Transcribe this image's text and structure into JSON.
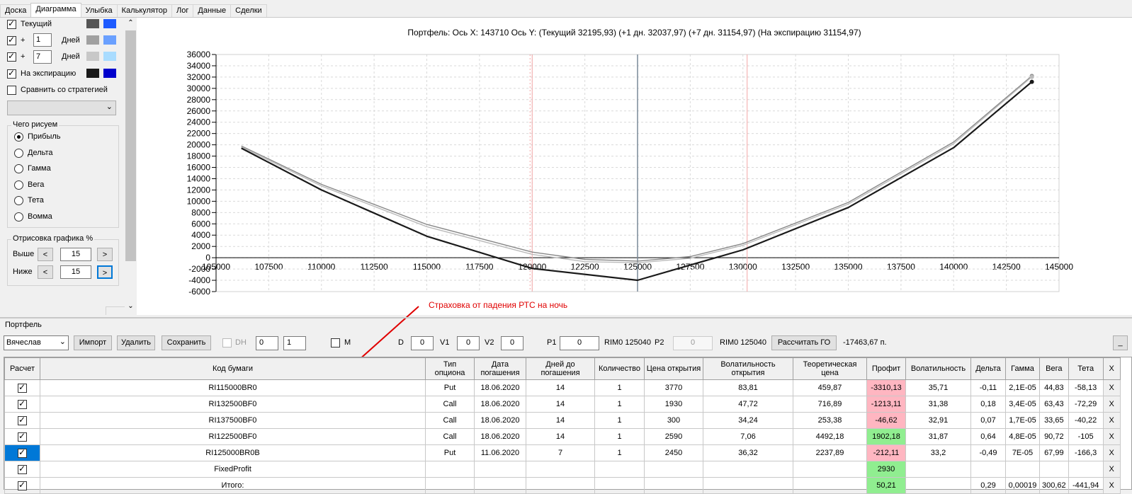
{
  "tabs": [
    "Доска",
    "Диаграмма",
    "Улыбка",
    "Калькулятор",
    "Лог",
    "Данные",
    "Сделки"
  ],
  "left": {
    "current_label": "Текущий",
    "plus_sign": "+",
    "plus1_value": "1",
    "days_label": "Дней",
    "plus7_value": "7",
    "expiry_label": "На экспирацию",
    "compare_label": "Сравнить со стратегией",
    "what_title": "Чего рисуем",
    "radios": [
      "Прибыль",
      "Дельта",
      "Гамма",
      "Вега",
      "Тета",
      "Вомма"
    ],
    "render_title": "Отрисовка графика %",
    "above_label": "Выше",
    "below_label": "Ниже",
    "above_value": "15",
    "below_value": "15",
    "prev": "<",
    "next": ">",
    "colors": {
      "current": [
        "#555555",
        "#1e5bff"
      ],
      "plus1": [
        "#a0a0a0",
        "#6aa0ff"
      ],
      "plus7": [
        "#c8c8c8",
        "#a9dcff"
      ],
      "expiry": [
        "#1a1a1a",
        "#0000cc"
      ]
    }
  },
  "chart": {
    "header": "Портфель: Ось X: 143710 Ось Y:  (Текущий 32195,93)  (+1 дн. 32037,97)  (+7 дн. 31154,97)  (На экспирацию 31154,97)",
    "annotation": "Страховка от падения РТС на ночь"
  },
  "chart_data": {
    "type": "line",
    "xlim": [
      105000,
      145000
    ],
    "ylim": [
      -6000,
      36000
    ],
    "x_ticks": [
      "105000",
      "107500",
      "110000",
      "112500",
      "115000",
      "117500",
      "120000",
      "122500",
      "125000",
      "127500",
      "130000",
      "132500",
      "135000",
      "137500",
      "140000",
      "142500",
      "145000"
    ],
    "y_ticks": [
      "36000",
      "34000",
      "32000",
      "30000",
      "28000",
      "26000",
      "24000",
      "22000",
      "20000",
      "18000",
      "16000",
      "14000",
      "12000",
      "10000",
      "8000",
      "6000",
      "4000",
      "2000",
      "0",
      "-2000",
      "-4000",
      "-6000"
    ],
    "vlines": {
      "current_price": 125000,
      "lower": 120000,
      "upper": 130200
    },
    "series": [
      {
        "color": "#888888",
        "x": [
          106200,
          110000,
          115000,
          120000,
          122500,
          125000,
          127500,
          130000,
          135000,
          140000,
          143710
        ],
        "y": [
          19800,
          13000,
          5900,
          1000,
          -300,
          -600,
          200,
          2500,
          9800,
          20500,
          32196
        ]
      },
      {
        "color": "#bbbbbb",
        "x": [
          106200,
          110000,
          115000,
          120000,
          122500,
          125000,
          127500,
          130000,
          135000,
          140000,
          143710
        ],
        "y": [
          19600,
          12700,
          5500,
          600,
          -700,
          -900,
          -100,
          2200,
          9500,
          20200,
          32038
        ]
      },
      {
        "color": "#1a1a1a",
        "x": [
          106200,
          110000,
          115000,
          120000,
          125000,
          130000,
          135000,
          140000,
          143710
        ],
        "y": [
          19400,
          12000,
          3800,
          -1900,
          -4000,
          1400,
          8900,
          19500,
          31155
        ]
      }
    ]
  },
  "portfolio": {
    "title": "Портфель",
    "user": "Вячеслав",
    "import": "Импорт",
    "delete": "Удалить",
    "save": "Сохранить",
    "dh": "DH",
    "dh_a": "0",
    "dh_b": "1",
    "m": "M",
    "d_label": "D",
    "d_value": "0",
    "v1_label": "V1",
    "v1_value": "0",
    "v2_label": "V2",
    "v2_value": "0",
    "p1_label": "P1",
    "p1_value": "0",
    "rim1": "RIM0 125040",
    "p2_label": "P2",
    "p2_value": "0",
    "rim2": "RIM0 125040",
    "calc_go": "Рассчитать ГО",
    "go_value": "-17463,67 п.",
    "min_btn": "_"
  },
  "table": {
    "headers": [
      "Расчет",
      "Код бумаги",
      "Тип опциона",
      "Дата погашения",
      "Дней до погашения",
      "Количество",
      "Цена открытия",
      "Волатильность открытия",
      "Теоретическая цена",
      "Профит",
      "Волатильность",
      "Дельта",
      "Гамма",
      "Вега",
      "Тета",
      "X"
    ],
    "rows": [
      [
        "RI115000BR0",
        "Put",
        "18.06.2020",
        "14",
        "1",
        "3770",
        "83,81",
        "459,87",
        "-3310,13",
        "35,71",
        "-0,11",
        "2,1E-05",
        "44,83",
        "-58,13"
      ],
      [
        "RI132500BF0",
        "Call",
        "18.06.2020",
        "14",
        "1",
        "1930",
        "47,72",
        "716,89",
        "-1213,11",
        "31,38",
        "0,18",
        "3,4E-05",
        "63,43",
        "-72,29"
      ],
      [
        "RI137500BF0",
        "Call",
        "18.06.2020",
        "14",
        "1",
        "300",
        "34,24",
        "253,38",
        "-46,62",
        "32,91",
        "0,07",
        "1,7E-05",
        "33,65",
        "-40,22"
      ],
      [
        "RI122500BF0",
        "Call",
        "18.06.2020",
        "14",
        "1",
        "2590",
        "7,06",
        "4492,18",
        "1902,18",
        "31,87",
        "0,64",
        "4,8E-05",
        "90,72",
        "-105"
      ],
      [
        "RI125000BR0B",
        "Put",
        "11.06.2020",
        "7",
        "1",
        "2450",
        "36,32",
        "2237,89",
        "-212,11",
        "33,2",
        "-0,49",
        "7E-05",
        "67,99",
        "-166,3"
      ],
      [
        "FixedProfit",
        "",
        "",
        "",
        "",
        "",
        "",
        "",
        "2930",
        "",
        "",
        "",
        "",
        ""
      ],
      [
        "Итого:",
        "",
        "",
        "",
        "",
        "",
        "",
        "",
        "50,21",
        "",
        "0,29",
        "0,00019",
        "300,62",
        "-441,94"
      ]
    ],
    "profit_colors": [
      "red",
      "red",
      "red",
      "green",
      "red",
      "green",
      "green"
    ],
    "x_label": "X"
  }
}
